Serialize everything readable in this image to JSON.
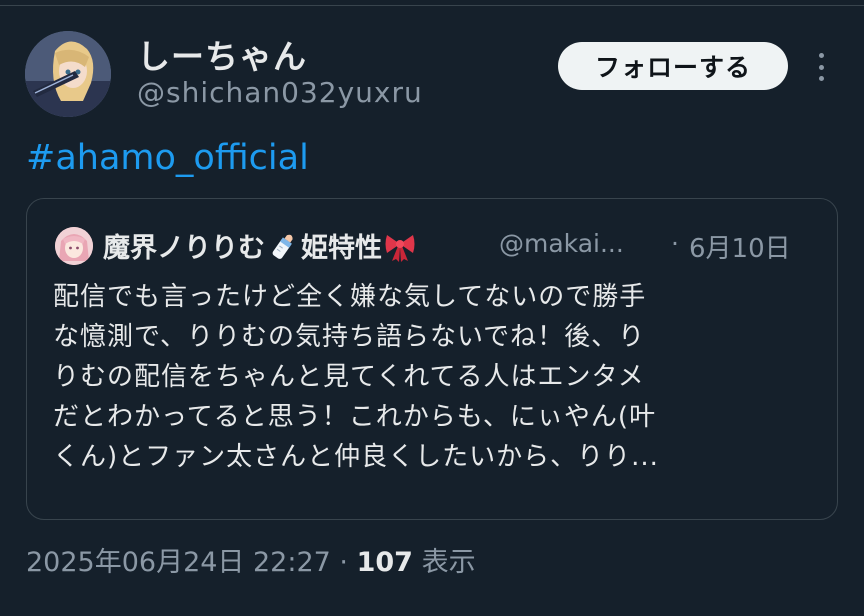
{
  "author": {
    "display_name": "しーちゃん",
    "handle": "@shichan032yuxru"
  },
  "follow_label": "フォローする",
  "hashtag": "#ahamo_official",
  "quoted": {
    "name_part1": "魔界ノりりむ",
    "name_part2": "姫特性",
    "handle": "@makai...",
    "separator": "·",
    "date": "6月10日",
    "lines": [
      "配信でも言ったけど全く嫌な気してないので勝手",
      "な憶測で、りりむの気持ち語らないでね！後、り",
      "りむの配信をちゃんと見てくれてる人はエンタメ",
      "だとわかってると思う！これからも、にぃやん(叶",
      "くん)とファン太さんと仲良くしたいから、りり..."
    ]
  },
  "meta": {
    "timestamp": "2025年06月24日 22:27",
    "separator": "·",
    "views": "107",
    "views_label": "表示"
  },
  "icons": [
    "avatar",
    "baby-bottle-icon",
    "ribbon-icon",
    "more-icon"
  ],
  "colors": {
    "background": "#15202b",
    "link": "#1d9bf0",
    "muted": "#8b98a5",
    "text": "#e7e9ea",
    "border": "#38444d"
  }
}
